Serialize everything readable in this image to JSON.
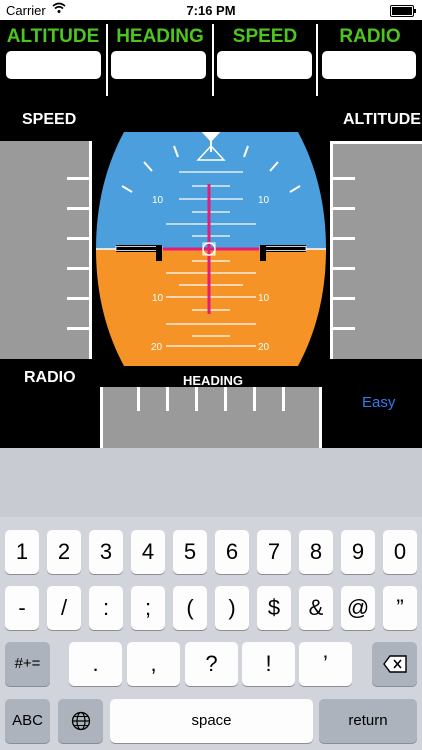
{
  "status_bar": {
    "carrier": "Carrier",
    "time": "7:16 PM"
  },
  "top_fields": [
    {
      "label": "ALTITUDE",
      "value": ""
    },
    {
      "label": "HEADING",
      "value": ""
    },
    {
      "label": "SPEED",
      "value": ""
    },
    {
      "label": "RADIO",
      "value": ""
    }
  ],
  "instrument": {
    "speed_label": "SPEED",
    "altitude_label": "ALTITUDE",
    "radio_label": "RADIO",
    "heading_label": "HEADING",
    "easy_button": "Easy",
    "pitch_labels": {
      "sky_10_left": "10",
      "sky_10_right": "10",
      "ground_10_left": "10",
      "ground_10_right": "10",
      "ground_20_left": "20",
      "ground_20_right": "20"
    },
    "colors": {
      "sky": "#4a9fdc",
      "ground": "#f59326",
      "cross": "#e21d7a",
      "accent_label": "#4cc61c"
    }
  },
  "keyboard": {
    "row1": [
      "1",
      "2",
      "3",
      "4",
      "5",
      "6",
      "7",
      "8",
      "9",
      "0"
    ],
    "row2": [
      "-",
      "/",
      ":",
      ";",
      "(",
      ")",
      "$",
      "&",
      "@",
      "”"
    ],
    "row3": [
      "#+=",
      ".",
      ",",
      "?",
      "!",
      "’"
    ],
    "row4": {
      "abc": "ABC",
      "space": "space",
      "return": "return"
    },
    "icons": {
      "globe": "globe-icon",
      "backspace": "backspace-icon"
    }
  }
}
